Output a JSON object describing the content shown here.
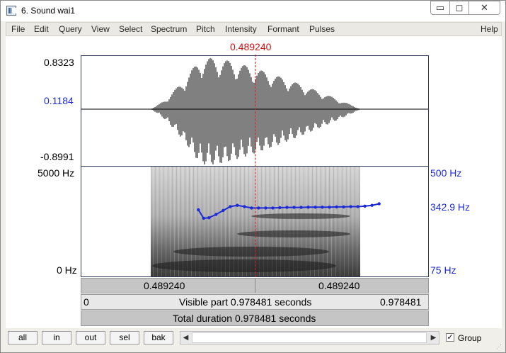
{
  "window": {
    "title": "6. Sound wai1",
    "minimize_glyph": "▭",
    "maximize_glyph": "◻",
    "close_glyph": "✕",
    "icon": "sound-window-icon"
  },
  "menu": [
    "File",
    "Edit",
    "Query",
    "View",
    "Select",
    "Spectrum",
    "Pitch",
    "Intensity",
    "Formant",
    "Pulses"
  ],
  "help": "Help",
  "cursor": {
    "time_label": "0.489240",
    "time": 0.48924
  },
  "waveform": {
    "max_label": "0.8323",
    "cursor_value_label": "0.1184",
    "min_label": "-0.8991"
  },
  "spectrogram": {
    "top_freq_label": "5000 Hz",
    "bottom_freq_label": "0 Hz",
    "pitch_top_label": "500 Hz",
    "pitch_value_label": "342.9 Hz",
    "pitch_bottom_label": "75 Hz"
  },
  "time_bars": {
    "left_segment": "0.489240",
    "right_segment": "0.489240",
    "visible_start": "0",
    "visible_part": "Visible part 0.978481 seconds",
    "visible_end": "0.978481",
    "total_duration": "Total duration 0.978481 seconds"
  },
  "buttons": {
    "all": "all",
    "in": "in",
    "out": "out",
    "sel": "sel",
    "bak": "bak"
  },
  "scroll": {
    "left_arrow": "◀",
    "right_arrow": "▶"
  },
  "group": {
    "label": "Group",
    "checked_glyph": "✓"
  },
  "colors": {
    "cursor": "#d01010",
    "pitch": "#1c2bd6",
    "panel_border": "#2c3c58"
  },
  "chart_data": {
    "type": "line",
    "title": "",
    "xlabel": "",
    "ylabel": "",
    "xlim": [
      0,
      0.978481
    ],
    "ylim": [
      75,
      500
    ],
    "series": [
      {
        "x": [
          0.33,
          0.345,
          0.36,
          0.38,
          0.4,
          0.42,
          0.44,
          0.46,
          0.48,
          0.5,
          0.52,
          0.54,
          0.56,
          0.58,
          0.6,
          0.62,
          0.64,
          0.66,
          0.68,
          0.7,
          0.72,
          0.74,
          0.76,
          0.78,
          0.8,
          0.82,
          0.84
        ],
        "values": [
          333,
          300,
          302,
          315,
          330,
          345,
          350,
          345,
          340,
          340,
          340,
          340,
          341,
          342,
          342,
          342,
          343,
          343,
          343,
          343,
          344,
          344,
          345,
          345,
          347,
          350,
          356
        ]
      }
    ]
  }
}
